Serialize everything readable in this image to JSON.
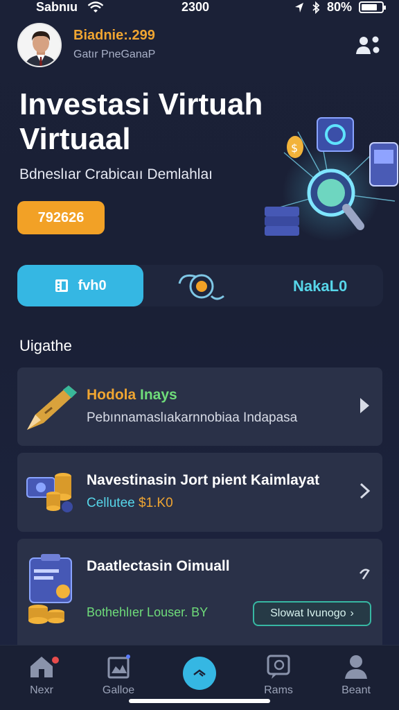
{
  "status_bar": {
    "carrier": "Sabnıu",
    "time": "2300",
    "battery": "80%",
    "battery_level": 0.8
  },
  "profile": {
    "name": "Biadnie:.299",
    "subtitle": "Gatır PneGanaP"
  },
  "hero": {
    "title": "Investasi Virtuah Virtuaal",
    "subtitle": "Bdneslıar Crabicaıı Demlahlaı",
    "balance": "792626"
  },
  "tabs": {
    "active_label": "fvh0",
    "right_label": "NakaL0"
  },
  "section": {
    "title": "Uigathe"
  },
  "cards": [
    {
      "title": "Hodola Inays",
      "subtitle": "Pebınnamaslıakarnnobiaa Indapasa",
      "title_color": "#f0a531",
      "title_color_2": "#6fdc7a"
    },
    {
      "title": "Navestinasin Jort pient Kaimlayat",
      "subtitle_prefix": "Cellutee",
      "subtitle_value": "$1.K0"
    },
    {
      "title": "Daatlectasin Oimuall",
      "footer_text": "Bothehlıer Louser. BY",
      "cta_label": "Slowat Ivunogo"
    }
  ],
  "bottom_nav": {
    "items": [
      {
        "label": "Nexr",
        "icon": "home-icon"
      },
      {
        "label": "Galloe",
        "icon": "gallery-icon"
      },
      {
        "label": "",
        "icon": "center-action-icon"
      },
      {
        "label": "Rams",
        "icon": "chat-icon"
      },
      {
        "label": "Beant",
        "icon": "profile-icon"
      }
    ]
  },
  "colors": {
    "background": "#1b2137",
    "accent": "#35b7e3",
    "orange": "#f2a126",
    "card": "#2a3148",
    "green": "#37b8a3"
  }
}
